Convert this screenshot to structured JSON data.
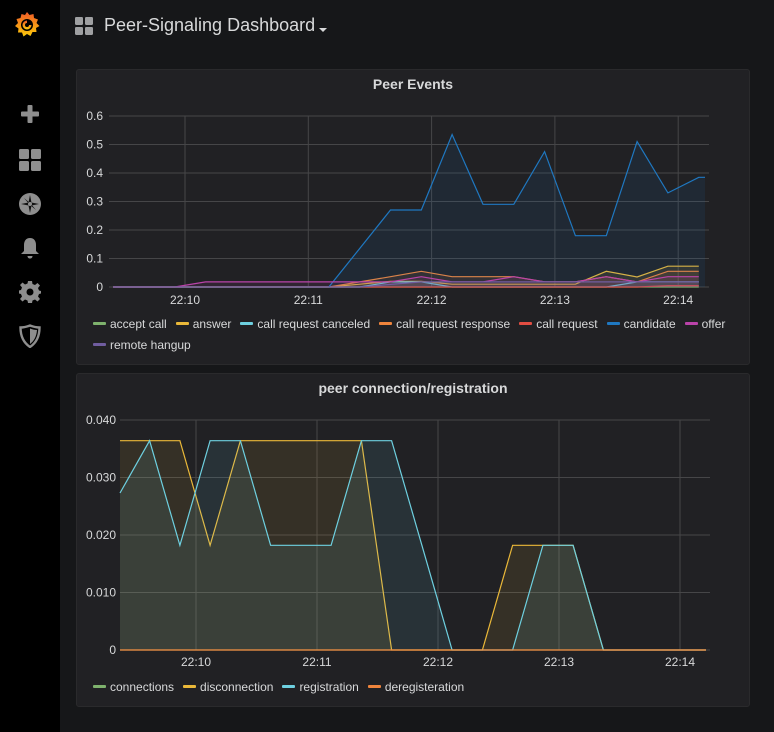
{
  "app": {
    "name": "Grafana",
    "dashboard_title": "Peer-Signaling Dashboard"
  },
  "sidemenu": {
    "items": [
      {
        "name": "create",
        "icon": "plus-icon"
      },
      {
        "name": "dashboards",
        "icon": "dashboards-icon"
      },
      {
        "name": "explore",
        "icon": "compass-icon"
      },
      {
        "name": "alerting",
        "icon": "bell-icon"
      },
      {
        "name": "configuration",
        "icon": "gear-icon"
      },
      {
        "name": "server-admin",
        "icon": "shield-icon"
      }
    ]
  },
  "colors": {
    "green": "#7eb26d",
    "yellow": "#eab839",
    "cyan": "#6ed0e0",
    "orange": "#ef843c",
    "red": "#e24d42",
    "blue": "#1f78c1",
    "pink": "#ba43a9",
    "purple": "#705da0"
  },
  "chart_data": [
    {
      "type": "area",
      "title": "Peer Events",
      "xlabel": "",
      "ylabel": "",
      "x_ticks": [
        "22:10",
        "22:11",
        "22:12",
        "22:13",
        "22:14"
      ],
      "y_ticks": [
        "0",
        "0.1",
        "0.2",
        "0.3",
        "0.4",
        "0.5",
        "0.6"
      ],
      "ylim": [
        0,
        0.6
      ],
      "grid": true,
      "legend_position": "bottom",
      "x": [
        "22:09:25",
        "22:09:40",
        "22:09:55",
        "22:10:10",
        "22:10:25",
        "22:10:40",
        "22:10:55",
        "22:11:10",
        "22:11:25",
        "22:11:40",
        "22:11:55",
        "22:12:10",
        "22:12:25",
        "22:12:40",
        "22:12:55",
        "22:13:10",
        "22:13:25",
        "22:13:40",
        "22:13:55",
        "22:14:10"
      ],
      "series": [
        {
          "name": "accept call",
          "color": "#7eb26d",
          "values": [
            0,
            0,
            0,
            0,
            0,
            0,
            0,
            0,
            0,
            0,
            0,
            0,
            0,
            0,
            0,
            0,
            0,
            0,
            0,
            0
          ]
        },
        {
          "name": "answer",
          "color": "#eab839",
          "values": [
            0,
            0,
            0,
            0,
            0,
            0,
            0,
            0,
            0.01,
            0.02,
            0.02,
            0.01,
            0.01,
            0.01,
            0.01,
            0.01,
            0.055,
            0.035,
            0.073,
            0.073
          ]
        },
        {
          "name": "call request canceled",
          "color": "#6ed0e0",
          "values": [
            0,
            0,
            0,
            0,
            0,
            0,
            0,
            0,
            0,
            0.018,
            0.018,
            0,
            0,
            0,
            0,
            0,
            0,
            0.018,
            0.018,
            0.018
          ]
        },
        {
          "name": "call request response",
          "color": "#ef843c",
          "values": [
            0,
            0,
            0,
            0,
            0,
            0,
            0,
            0,
            0.018,
            0.036,
            0.055,
            0.036,
            0.036,
            0.036,
            0.018,
            0.018,
            0.036,
            0.018,
            0.055,
            0.055
          ]
        },
        {
          "name": "call request",
          "color": "#e24d42",
          "values": [
            0,
            0,
            0,
            0,
            0,
            0,
            0,
            0,
            0,
            0,
            0,
            0,
            0,
            0,
            0,
            0,
            0,
            0,
            0.005,
            0.005
          ]
        },
        {
          "name": "candidate",
          "color": "#1f78c1",
          "values": [
            0,
            0,
            0,
            0,
            0,
            0,
            0,
            0,
            0.135,
            0.27,
            0.27,
            0.535,
            0.29,
            0.29,
            0.475,
            0.18,
            0.18,
            0.51,
            0.33,
            0.385,
            0.385
          ]
        },
        {
          "name": "offer",
          "color": "#ba43a9",
          "values": [
            0,
            0,
            0,
            0.018,
            0.018,
            0.018,
            0.018,
            0.018,
            0.018,
            0.018,
            0.036,
            0.018,
            0.018,
            0.036,
            0.018,
            0.018,
            0.036,
            0.018,
            0.036,
            0.036
          ]
        },
        {
          "name": "remote hangup",
          "color": "#705da0",
          "values": [
            0,
            0,
            0,
            0,
            0,
            0,
            0,
            0,
            0,
            0.009,
            0.018,
            0.018,
            0.018,
            0.018,
            0.018,
            0.018,
            0.018,
            0.018,
            0.018,
            0.018
          ]
        }
      ]
    },
    {
      "type": "area",
      "title": "peer connection/registration",
      "xlabel": "",
      "ylabel": "",
      "x_ticks": [
        "22:10",
        "22:11",
        "22:12",
        "22:13",
        "22:14"
      ],
      "y_ticks": [
        "0",
        "0.010",
        "0.020",
        "0.030",
        "0.040"
      ],
      "ylim": [
        0,
        0.04
      ],
      "grid": true,
      "legend_position": "bottom",
      "x": [
        "22:09:22",
        "22:09:37",
        "22:09:52",
        "22:10:07",
        "22:10:22",
        "22:10:37",
        "22:10:52",
        "22:11:07",
        "22:11:22",
        "22:11:37",
        "22:11:52",
        "22:12:07",
        "22:12:22",
        "22:12:37",
        "22:12:52",
        "22:13:07",
        "22:13:22",
        "22:13:37",
        "22:13:52",
        "22:14:07",
        "22:14:15"
      ],
      "series": [
        {
          "name": "connections",
          "color": "#7eb26d",
          "values": [
            0,
            0,
            0,
            0,
            0,
            0,
            0,
            0,
            0,
            0,
            0,
            0,
            0,
            0,
            0,
            0,
            0,
            0,
            0,
            0,
            0
          ]
        },
        {
          "name": "disconnection",
          "color": "#eab839",
          "values": [
            0.0364,
            0.0364,
            0.0364,
            0.0182,
            0.0364,
            0.0364,
            0.0364,
            0.0364,
            0.0364,
            0,
            0,
            0,
            0,
            0.0182,
            0.0182,
            0.0182,
            0,
            0,
            0,
            0,
            0
          ]
        },
        {
          "name": "registration",
          "color": "#6ed0e0",
          "values": [
            0.0273,
            0.0364,
            0.0182,
            0.0364,
            0.0364,
            0.0182,
            0.0182,
            0.0182,
            0.0364,
            0.0364,
            0.0182,
            0,
            0,
            0,
            0.0182,
            0.0182,
            0,
            0,
            0,
            0,
            0
          ]
        },
        {
          "name": "deregisteration",
          "color": "#ef843c",
          "values": [
            0,
            0,
            0,
            0,
            0,
            0,
            0,
            0,
            0,
            0,
            0,
            0,
            0,
            0,
            0,
            0,
            0,
            0,
            0,
            0,
            0
          ]
        }
      ]
    }
  ],
  "panels": [
    {
      "title": "Peer Events",
      "legend": [
        "accept call",
        "answer",
        "call request canceled",
        "call request response",
        "call request",
        "candidate",
        "offer",
        "remote hangup"
      ]
    },
    {
      "title": "peer connection/registration",
      "legend": [
        "connections",
        "disconnection",
        "registration",
        "deregisteration"
      ]
    }
  ]
}
